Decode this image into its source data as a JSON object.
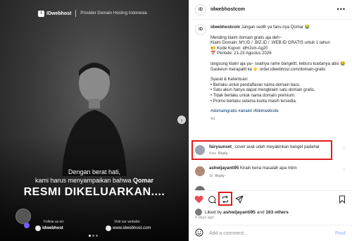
{
  "media": {
    "brand_name": "IDwebhost",
    "brand_tagline": "Provider Domain Hosting Indonesia",
    "caption_line1": "Dengan berat hati,",
    "caption_line2_prefix": "kami harus menyampaikan bahwa ",
    "caption_line2_bold": "Qomar",
    "headline": "RESMI DIKELUARKAN....",
    "follow_label": "Follow us on:",
    "follow_brand": "idwebhost",
    "visit_label": "Visit our website:",
    "visit_url": "www.idwebhost.com",
    "slide_count": 3,
    "active_slide": 1
  },
  "post": {
    "username": "idwebhostcom",
    "caption_user": "idwebhostcom",
    "caption_intro": "Jangan sedih ya fans-nya Qomar 😭",
    "caption_lines": [
      "Mending klaim domain gratis aja deh~",
      "Klaim Domain .MY.ID / .BIZ.ID / .WEB.ID GRATIS untuk 1 tahun",
      "🎫 Kode Kupon: idHJsm-Ag20",
      "📅 Periode: 21-23 Agustus 2026",
      "",
      "langsung klaim aja ya~ soalnya rame bangettt, keburu kuotanya abis 😭",
      "Gaskeun merapattt ke 👉 order.idwebhost.com/domain-gratis",
      "",
      "Syarat & Ketentuan:",
      "• Berlaku untuk pendaftaran nama domain baru.",
      "• Satu akun hanya dapat mengklaim satu domain gratis.",
      "• Tidak berlaku untuk nama domain premium.",
      "• Promo berlaku selama kuota masih tersedia."
    ],
    "hashtags": "#domaingratis #analot #bikinwebsite",
    "caption_age": "4d"
  },
  "comments": [
    {
      "user": "fairysunset_",
      "text": "cover avat udah meyakinkan banget padahal",
      "age": "Now",
      "reply": "Reply"
    },
    {
      "user": "ashwijayanti95",
      "text": "Kirain kena masalah apa minn",
      "age": "3d",
      "reply": "Reply"
    },
    {
      "user": "",
      "text": "",
      "age": "",
      "reply": ""
    }
  ],
  "likes": {
    "prefix": "Liked by",
    "user": "ashwijayanti95",
    "middle": "and",
    "others": "163 others",
    "age": "4 days ago"
  },
  "add_comment": {
    "placeholder": "Add a comment...",
    "post_label": "Post"
  },
  "icons": [
    "more-icon",
    "heart-icon",
    "comment-icon",
    "repost-icon",
    "share-icon",
    "bookmark-icon",
    "emoji-icon"
  ],
  "colors": {
    "highlight": "#e01d1d",
    "like_red": "#ed4956",
    "link_blue": "#00376b",
    "post_blue": "#a7c6f2"
  }
}
